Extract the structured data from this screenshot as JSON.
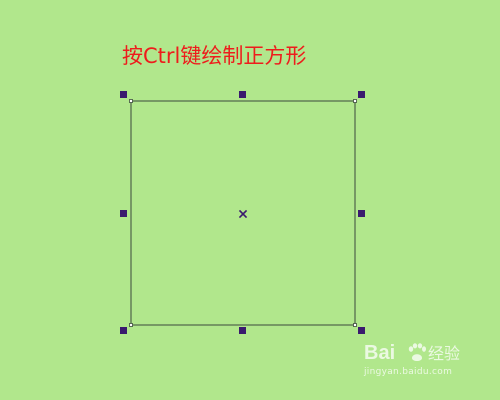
{
  "instruction": {
    "text": "按Ctrl键绘制正方形",
    "color": "#ee1c1c"
  },
  "canvas": {
    "background": "#b1e78c",
    "shape_type": "square",
    "outline_color": "#3c4a3c",
    "handle_color": "#3a1a6e",
    "center_marker_icon": "x-center-icon",
    "handles": [
      "top-left",
      "top-center",
      "top-right",
      "middle-left",
      "middle-right",
      "bottom-left",
      "bottom-center",
      "bottom-right"
    ]
  },
  "watermark": {
    "logo_text": "Bai",
    "paw_icon": "paw-icon",
    "brand_text": "经验",
    "url_text": "jingyan.baidu.com"
  }
}
